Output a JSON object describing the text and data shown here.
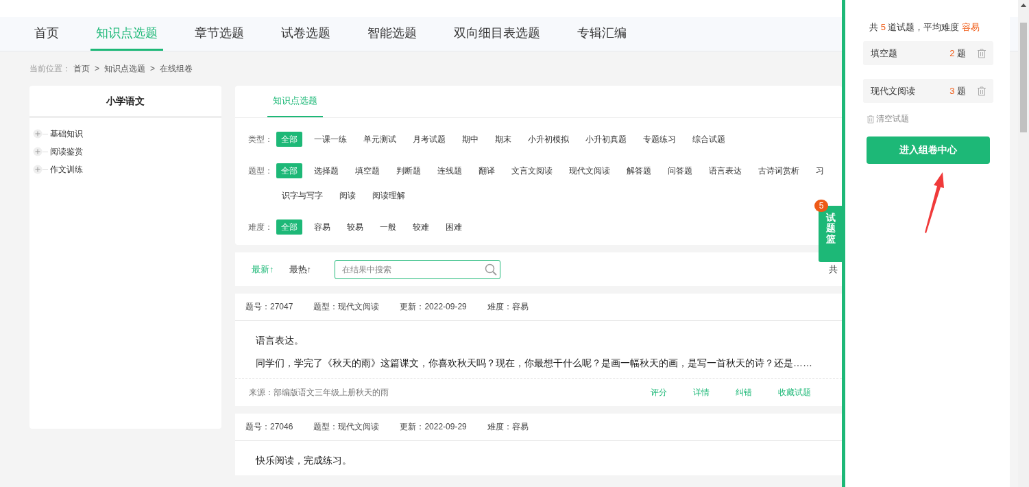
{
  "nav": {
    "tabs": [
      {
        "label": "首页",
        "selected": false
      },
      {
        "label": "知识点选题",
        "selected": true
      },
      {
        "label": "章节选题",
        "selected": false
      },
      {
        "label": "试卷选题",
        "selected": false
      },
      {
        "label": "智能选题",
        "selected": false
      },
      {
        "label": "双向细目表选题",
        "selected": false
      },
      {
        "label": "专辑汇编",
        "selected": false
      }
    ]
  },
  "breadcrumb": {
    "label": "当前位置：",
    "separator": ">",
    "items": [
      "首页",
      "知识点选题",
      "在线组卷"
    ]
  },
  "sidebar": {
    "title": "小学语文",
    "tree": [
      {
        "label": "基础知识",
        "expanded": false
      },
      {
        "label": "阅读鉴赏",
        "expanded": false
      },
      {
        "label": "作文训练",
        "expanded": false
      }
    ]
  },
  "filter": {
    "tabs": [
      {
        "label": "知识点选题",
        "selected": true
      }
    ],
    "groups": [
      {
        "label": "类型：",
        "lines": [
          [
            {
              "label": "全部",
              "selected": true
            },
            {
              "label": "一课一练",
              "selected": false
            },
            {
              "label": "单元测试",
              "selected": false
            },
            {
              "label": "月考试题",
              "selected": false
            },
            {
              "label": "期中",
              "selected": false
            },
            {
              "label": "期末",
              "selected": false
            },
            {
              "label": "小升初模拟",
              "selected": false
            },
            {
              "label": "小升初真题",
              "selected": false
            },
            {
              "label": "专题练习",
              "selected": false
            },
            {
              "label": "综合试题",
              "selected": false
            }
          ]
        ]
      },
      {
        "label": "题型：",
        "lines": [
          [
            {
              "label": "全部",
              "selected": true
            },
            {
              "label": "选择题",
              "selected": false
            },
            {
              "label": "填空题",
              "selected": false
            },
            {
              "label": "判断题",
              "selected": false
            },
            {
              "label": "连线题",
              "selected": false
            },
            {
              "label": "翻译",
              "selected": false
            },
            {
              "label": "文言文阅读",
              "selected": false
            },
            {
              "label": "现代文阅读",
              "selected": false
            },
            {
              "label": "解答题",
              "selected": false
            },
            {
              "label": "问答题",
              "selected": false
            },
            {
              "label": "语言表达",
              "selected": false
            },
            {
              "label": "古诗词赏析",
              "selected": false
            },
            {
              "label": "习",
              "selected": false
            }
          ],
          [
            {
              "label": "识字与写字",
              "selected": false
            },
            {
              "label": "阅读",
              "selected": false
            },
            {
              "label": "阅读理解",
              "selected": false
            }
          ]
        ]
      },
      {
        "label": "难度：",
        "lines": [
          [
            {
              "label": "全部",
              "selected": true
            },
            {
              "label": "容易",
              "selected": false
            },
            {
              "label": "较易",
              "selected": false
            },
            {
              "label": "一般",
              "selected": false
            },
            {
              "label": "较难",
              "selected": false
            },
            {
              "label": "困难",
              "selected": false
            }
          ]
        ]
      }
    ]
  },
  "sort": {
    "options": [
      {
        "label": "最新↑",
        "selected": true
      },
      {
        "label": "最热↑",
        "selected": false
      }
    ],
    "search": {
      "placeholder": "在结果中搜索"
    },
    "count_text": "共"
  },
  "questions": [
    {
      "meta": [
        "题号：27047",
        "题型：现代文阅读",
        "更新：2022-09-29",
        "难度：容易"
      ],
      "title": "语言表达。",
      "body": "同学们，学完了《秋天的雨》这篇课文，你喜欢秋天吗？现在，你最想干什么呢？是画一幅秋天的画，是写一首秋天的诗？还是……",
      "source": "来源：部编版语文三年级上册秋天的雨",
      "actions": [
        "评分",
        "详情",
        "纠错",
        "收藏试题"
      ]
    },
    {
      "meta": [
        "题号：27046",
        "题型：现代文阅读",
        "更新：2022-09-29",
        "难度：容易"
      ],
      "title": "快乐阅读，完成练习。"
    }
  ],
  "basket_tab": {
    "label": "试题篮",
    "count": "5"
  },
  "basket": {
    "summary": {
      "prefix": "共",
      "count": "5",
      "middle": "道试题，平均难度",
      "level": "容易"
    },
    "items": [
      {
        "name": "填空题",
        "count": "2",
        "unit": "题"
      },
      {
        "name": "现代文阅读",
        "count": "3",
        "unit": "题"
      }
    ],
    "clear_label": "清空试题",
    "button": "进入组卷中心"
  }
}
